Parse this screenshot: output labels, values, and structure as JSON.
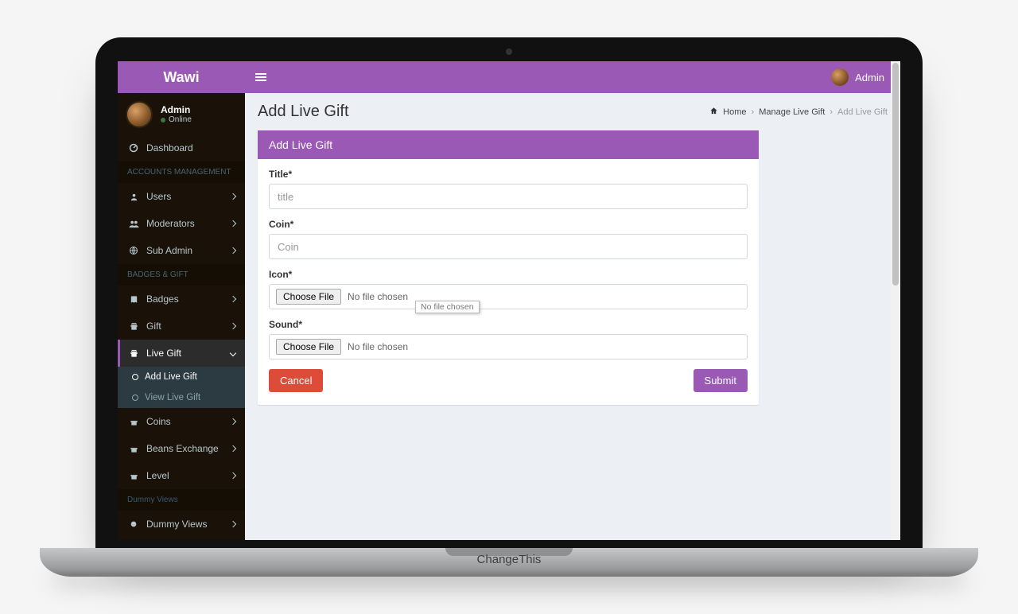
{
  "frame": {
    "footer_label": "ChangeThis"
  },
  "header": {
    "brand": "Wawi",
    "user_name": "Admin"
  },
  "sidebar": {
    "user": {
      "name": "Admin",
      "status": "Online"
    },
    "dashboard": "Dashboard",
    "sections": {
      "accounts": {
        "header": "ACCOUNTS MANAGEMENT",
        "users": "Users",
        "moderators": "Moderators",
        "sub_admin": "Sub Admin"
      },
      "badges": {
        "header": "BADGES & GIFT",
        "badges": "Badges",
        "gift": "Gift",
        "live_gift": "Live Gift",
        "sub_add": "Add Live Gift",
        "sub_view": "View Live Gift",
        "coins": "Coins",
        "beans": "Beans Exchange",
        "level": "Level"
      },
      "dummy": {
        "header": "Dummy Views",
        "dummy_views": "Dummy Views"
      }
    }
  },
  "page": {
    "title": "Add Live Gift",
    "breadcrumb": {
      "home": "Home",
      "parent": "Manage Live Gift",
      "current": "Add Live Gift"
    },
    "panel_title": "Add Live Gift",
    "form": {
      "title_label": "Title*",
      "title_placeholder": "title",
      "coin_label": "Coin*",
      "coin_placeholder": "Coin",
      "icon_label": "Icon*",
      "sound_label": "Sound*",
      "choose_file": "Choose File",
      "no_file": "No file chosen",
      "tooltip": "No file chosen",
      "cancel": "Cancel",
      "submit": "Submit"
    }
  }
}
